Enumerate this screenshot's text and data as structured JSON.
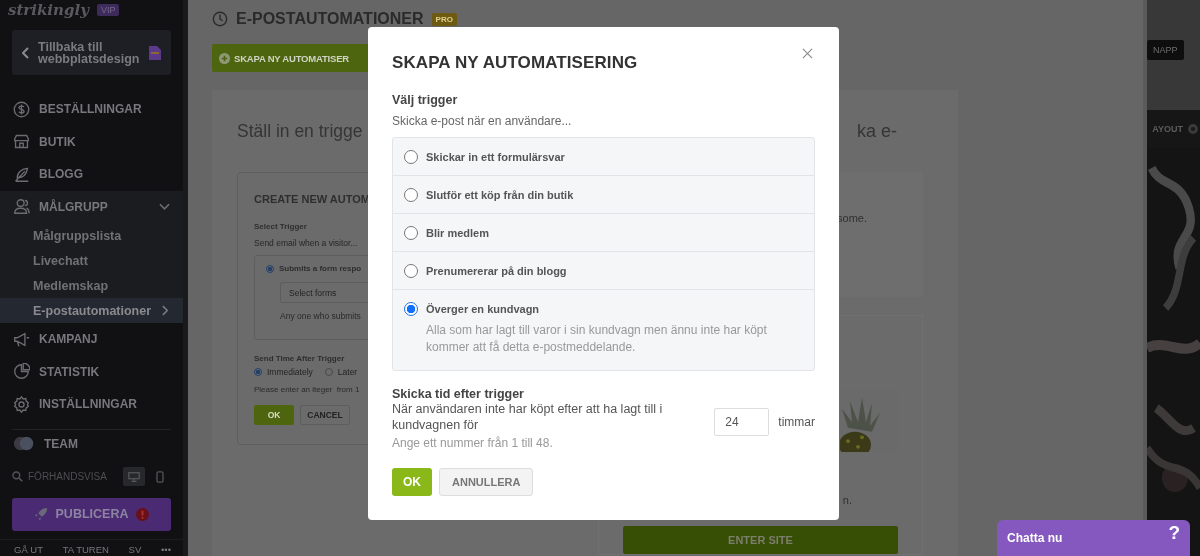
{
  "sidebar": {
    "logo": "strikingly",
    "badge": "VIP",
    "back_button": "Tillbaka till webbplatsdesign",
    "nav": [
      {
        "label": "BESTÄLLNINGAR"
      },
      {
        "label": "BUTIK"
      },
      {
        "label": "BLOGG"
      },
      {
        "label": "MÅLGRUPP",
        "expanded": true,
        "children": [
          {
            "label": "Målgruppslista",
            "selected": false
          },
          {
            "label": "Livechatt",
            "selected": false
          },
          {
            "label": "Medlemskap",
            "selected": false
          },
          {
            "label": "E-postautomationer",
            "selected": true
          }
        ]
      },
      {
        "label": "KAMPANJ"
      },
      {
        "label": "STATISTIK"
      },
      {
        "label": "INSTÄLLNINGAR"
      }
    ],
    "team": "TEAM",
    "preview": "FÖRHANDSVISA",
    "devices": [
      {
        "kind": "desktop",
        "selected": true
      },
      {
        "kind": "mobile",
        "selected": false
      }
    ],
    "publish": "PUBLICERA",
    "footer": [
      "GÅ UT",
      "TA TUREN",
      "SV",
      "•••"
    ]
  },
  "page": {
    "title": "E-POSTAUTOMATIONER",
    "badge": "PRO",
    "create_button": "SKAPA NY AUTOMATISER",
    "headline": [
      "Ställ in en trigge",
      "ka e-"
    ],
    "card": {
      "title": "CREATE NEW AUTOM",
      "trigger_label": "Select Trigger",
      "trigger_hint": "Send email when a visitor...",
      "option": {
        "label": "Submits a form respo",
        "selected": true
      },
      "select_placeholder": "Select forms",
      "option_note": "Any one who submits",
      "send_time_label": "Send Time After Trigger",
      "timing": [
        {
          "label": "Immediately",
          "selected": true
        },
        {
          "label": "Later",
          "selected": false
        }
      ],
      "hint": "Please enter an iteger  from 1",
      "ok": "OK",
      "cancel": "CANCEL"
    },
    "preview_texts": [
      "some.",
      "n."
    ],
    "enter_button": "ENTER SITE"
  },
  "site": {
    "button": "NAPP",
    "layout": "AYOUT"
  },
  "modal": {
    "title": "SKAPA NY AUTOMATISERING",
    "trigger_label": "Välj trigger",
    "trigger_hint": "Skicka e-post när en användare...",
    "options": [
      {
        "label": "Skickar in ett formulärsvar",
        "selected": false
      },
      {
        "label": "Slutför ett köp från din butik",
        "selected": false
      },
      {
        "label": "Blir medlem",
        "selected": false
      },
      {
        "label": "Prenumererar på din blogg",
        "selected": false
      },
      {
        "label": "Överger en kundvagn",
        "selected": true,
        "description": "Alla som har lagt till varor i sin kundvagn men ännu inte har köpt kommer att få detta e-postmeddelande."
      }
    ],
    "send_time_label": "Skicka tid efter trigger",
    "send_time_text": "När användaren inte har köpt efter att ha lagt till i kundvagnen för",
    "hours": "24",
    "unit": "timmar",
    "hint": "Ange ett nummer från 1 till 48.",
    "ok": "OK",
    "cancel": "ANNULLERA"
  },
  "chat": {
    "label": "Chatta nu",
    "help": "?"
  }
}
